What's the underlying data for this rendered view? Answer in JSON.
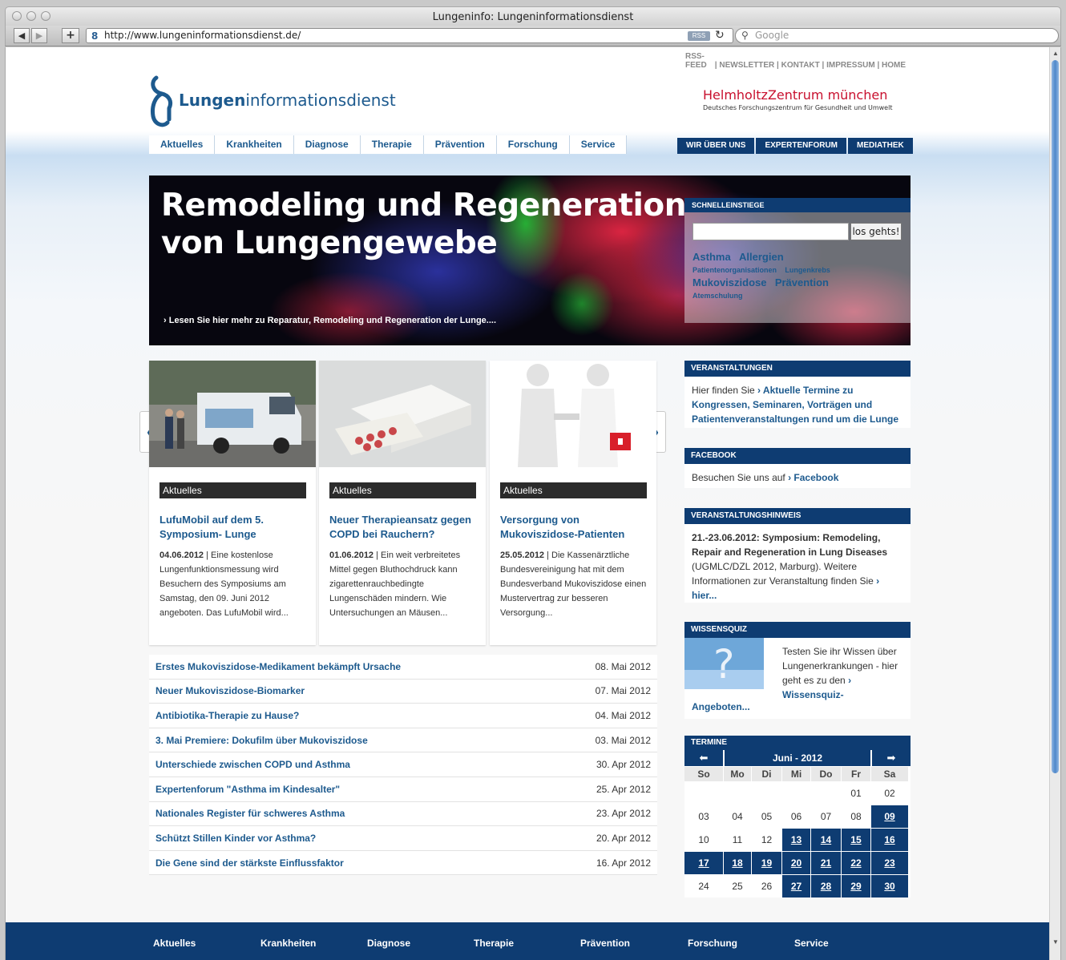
{
  "browser": {
    "window_title": "Lungeninfo: Lungeninformationsdienst",
    "url": "http://www.lungeninformationsdienst.de/",
    "rss_label": "RSS",
    "search_placeholder": "Google"
  },
  "header": {
    "toplinks": [
      "RSS-FEED",
      "NEWSLETTER",
      "KONTAKT",
      "IMPRESSUM",
      "HOME"
    ],
    "logo_bold": "Lungen",
    "logo_rest": "informationsdienst",
    "partner_name": "HelmholtzZentrum münchen",
    "partner_sub": "Deutsches Forschungszentrum für Gesundheit und Umwelt"
  },
  "nav": {
    "main": [
      "Aktuelles",
      "Krankheiten",
      "Diagnose",
      "Therapie",
      "Prävention",
      "Forschung",
      "Service"
    ],
    "sub": [
      "WIR ÜBER UNS",
      "EXPERTENFORUM",
      "MEDIATHEK"
    ]
  },
  "hero": {
    "title_line1": "Remodeling und Regeneration",
    "title_line2": "von Lungengewebe",
    "more": "› Lesen Sie hier mehr zu Reparatur, Remodeling und Regeneration der Lunge...."
  },
  "quick": {
    "heading": "SCHNELLEINSTIEGE",
    "button": "los gehts!",
    "tags": [
      {
        "label": "Asthma",
        "size": "l"
      },
      {
        "label": "Allergien",
        "size": "l"
      },
      {
        "label": "Patientenorganisationen",
        "size": "s"
      },
      {
        "label": "Lungenkrebs",
        "size": "s"
      },
      {
        "label": "Mukoviszidose",
        "size": "l"
      },
      {
        "label": "Prävention",
        "size": "l"
      },
      {
        "label": "Atemschulung",
        "size": "s"
      }
    ]
  },
  "carousel": {
    "prev": "«",
    "next": "»",
    "items": [
      {
        "category": "Aktuelles",
        "title": "LufuMobil auf dem 5. Symposium- Lunge",
        "date": "04.06.2012",
        "text": " | Eine kostenlose Lungenfunktionsmessung wird Besuchern des Symposiums am Samstag, den 09. Juni 2012 angeboten. Das LufuMobil wird..."
      },
      {
        "category": "Aktuelles",
        "title": "Neuer Therapieansatz gegen COPD bei Rauchern?",
        "date": "01.06.2012",
        "text": " | Ein weit verbreitetes Mittel gegen Bluthochdruck kann zigarettenrauchbedingte Lungenschäden mindern. Wie Untersuchungen an Mäusen..."
      },
      {
        "category": "Aktuelles",
        "title": "Versorgung von Mukoviszidose-Patienten",
        "date": "25.05.2012",
        "text": " | Die Kassenärztliche Bundesvereinigung hat mit dem Bundesverband Mukoviszidose einen Mustervertrag zur besseren Versorgung..."
      }
    ]
  },
  "news": [
    {
      "title": "Erstes Mukoviszidose-Medikament bekämpft Ursache",
      "date": "08. Mai 2012"
    },
    {
      "title": "Neuer Mukoviszidose-Biomarker",
      "date": "07. Mai 2012"
    },
    {
      "title": "Antibiotika-Therapie zu Hause?",
      "date": "04. Mai 2012"
    },
    {
      "title": "3. Mai Premiere: Dokufilm über Mukoviszidose",
      "date": "03. Mai 2012"
    },
    {
      "title": "Unterschiede zwischen COPD und Asthma",
      "date": "30. Apr 2012"
    },
    {
      "title": "Expertenforum \"Asthma im Kindesalter\"",
      "date": "25. Apr 2012"
    },
    {
      "title": "Nationales Register für schweres Asthma",
      "date": "23. Apr 2012"
    },
    {
      "title": "Schützt Stillen Kinder vor Asthma?",
      "date": "20. Apr 2012"
    },
    {
      "title": "Die Gene sind der stärkste Einflussfaktor",
      "date": "16. Apr 2012"
    }
  ],
  "sidebar": {
    "veranstaltungen": {
      "heading": "VERANSTALTUNGEN",
      "text": "Hier finden Sie ",
      "link": "› Aktuelle Termine zu Kongressen, Seminaren, Vorträgen und Patientenveranstaltungen rund um die Lunge"
    },
    "facebook": {
      "heading": "FACEBOOK",
      "text": "Besuchen Sie uns auf ",
      "link": "› Facebook"
    },
    "hinweis": {
      "heading": "VERANSTALTUNGSHINWEIS",
      "bold": "21.-23.06.2012: Symposium: Remodeling, Repair and Regeneration in Lung Diseases",
      "text": " (UGMLC/DZL 2012, Marburg). Weitere Informationen zur Veranstaltung finden Sie ",
      "link": "› hier..."
    },
    "quiz": {
      "heading": "WISSENSQUIZ",
      "text": "Testen Sie ihr Wissen über Lungenerkrankungen - hier geht es zu den ",
      "link": "› Wissensquiz-",
      "more": "Angeboten..."
    }
  },
  "calendar": {
    "heading": "TERMINE",
    "month": "Juni - 2012",
    "prev_icon": "arrow-left-icon",
    "next_icon": "arrow-right-icon",
    "weekdays": [
      "So",
      "Mo",
      "Di",
      "Mi",
      "Do",
      "Fr",
      "Sa"
    ],
    "weeks": [
      [
        "",
        "",
        "",
        "",
        "",
        "01",
        "02"
      ],
      [
        "03",
        "04",
        "05",
        "06",
        "07",
        "08",
        "09"
      ],
      [
        "10",
        "11",
        "12",
        "13",
        "14",
        "15",
        "16"
      ],
      [
        "17",
        "18",
        "19",
        "20",
        "21",
        "22",
        "23"
      ],
      [
        "24",
        "25",
        "26",
        "27",
        "28",
        "29",
        "30"
      ]
    ],
    "event_days": [
      "09",
      "13",
      "14",
      "15",
      "16",
      "17",
      "18",
      "19",
      "20",
      "21",
      "22",
      "23",
      "27",
      "28",
      "29",
      "30"
    ]
  },
  "footer": [
    "Aktuelles",
    "Krankheiten",
    "Diagnose",
    "Therapie",
    "Prävention",
    "Forschung",
    "Service"
  ],
  "colors": {
    "brand": "#0e3c72",
    "link": "#1d5a8e",
    "partner": "#c8102e"
  }
}
